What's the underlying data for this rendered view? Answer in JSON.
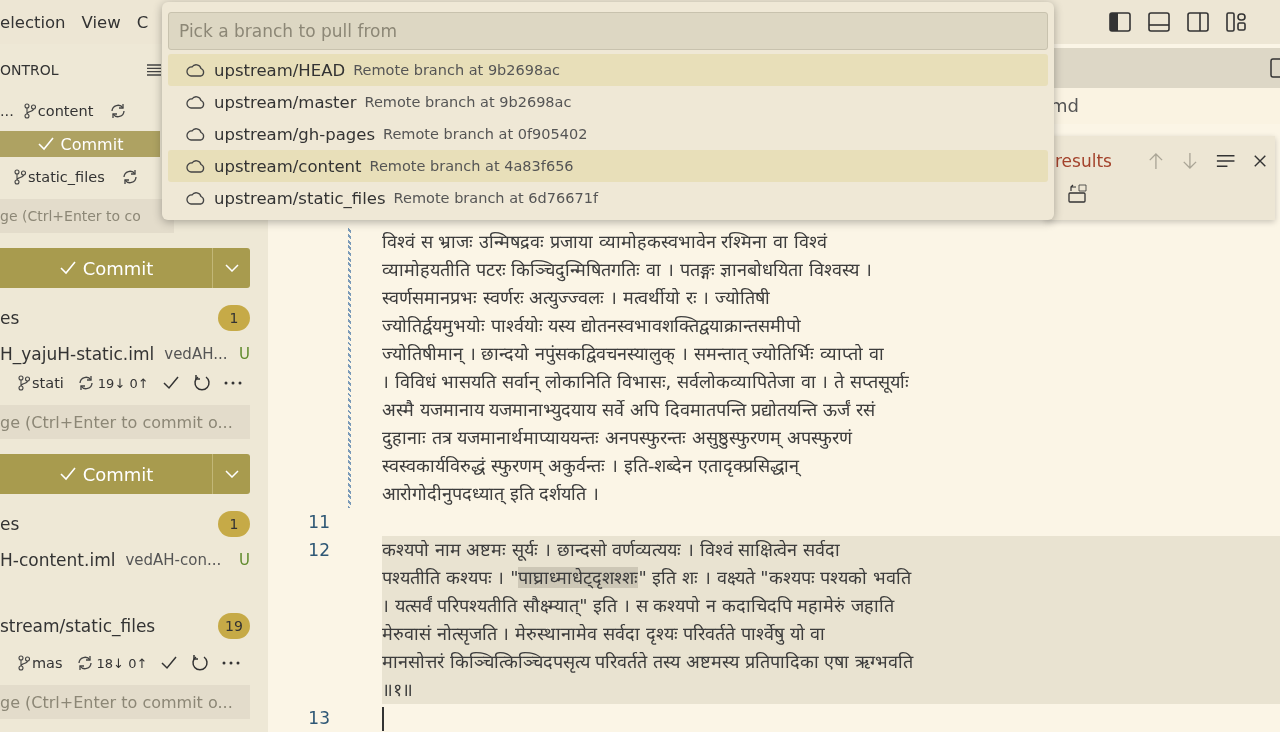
{
  "menu_bar": {
    "items": [
      "election",
      "View",
      "C"
    ]
  },
  "sidebar": {
    "title": "ONTROL",
    "rows": [
      {
        "kind": "branch",
        "prefix": "...",
        "branch": "content",
        "actions": false
      },
      {
        "kind": "commit",
        "label": "Commit",
        "disabled": true
      },
      {
        "kind": "branch",
        "branch": "static_files",
        "actions": false
      },
      {
        "kind": "input",
        "placeholder": "ge (Ctrl+Enter to co"
      },
      {
        "kind": "commit",
        "label": "Commit",
        "disabled": false
      },
      {
        "kind": "group",
        "label": "es",
        "count": "1"
      },
      {
        "kind": "file",
        "name": "H_yajuH-static.iml",
        "path": "vedAH...",
        "status": "U"
      },
      {
        "kind": "branch",
        "branch": "stati",
        "sync": "19↓ 0↑",
        "actions": true
      },
      {
        "kind": "input",
        "placeholder": "ge (Ctrl+Enter to commit o..."
      },
      {
        "kind": "commit",
        "label": "Commit",
        "disabled": false
      },
      {
        "kind": "group",
        "label": "es",
        "count": "1"
      },
      {
        "kind": "file",
        "name": "H-content.iml",
        "path": "vedAH-con...",
        "status": "U"
      },
      {
        "kind": "repo",
        "label": "stream/static_files",
        "count": "19"
      },
      {
        "kind": "branch",
        "branch": "mas",
        "sync": "18↓ 0↑",
        "actions": true
      },
      {
        "kind": "input",
        "placeholder": "ge (Ctrl+Enter to commit o..."
      }
    ]
  },
  "quick_pick": {
    "placeholder": "Pick a branch to pull from",
    "items": [
      {
        "label": "upstream/HEAD",
        "description": "Remote branch at 9b2698ac",
        "selected": true
      },
      {
        "label": "upstream/master",
        "description": "Remote branch at 9b2698ac",
        "selected": false
      },
      {
        "label": "upstream/gh-pages",
        "description": "Remote branch at 0f905402",
        "selected": false
      },
      {
        "label": "upstream/content",
        "description": "Remote branch at 4a83f656",
        "selected": true
      },
      {
        "label": "upstream/static_files",
        "description": "Remote branch at 6d76671f",
        "selected": false
      }
    ]
  },
  "breadcrumb": "md",
  "find_widget": {
    "result": "results"
  },
  "editor": {
    "lines": [
      {
        "modified": true,
        "current": false,
        "segments": [
          [
            {
              "text": "विश्वं स भ्राजः उन्मिषद्रवः प्रजाया व्यामोहकस्वभावेन रश्मिना वा विश्वं",
              "match": false
            }
          ],
          [
            {
              "text": "व्यामोहयतीति पटरः किञ्चिदुन्मिषितगतिः वा । पतङ्गः ज्ञानबोधयिता विश्वस्य ।",
              "match": false
            }
          ],
          [
            {
              "text": "स्वर्णसमानप्रभः स्वर्णरः अत्युज्ज्वलः । मत्वर्थीयो रः । ज्योतिषी",
              "match": false
            }
          ],
          [
            {
              "text": "ज्योतिर्द्वयमुभयोः पार्श्वयोः यस्य द्योतनस्वभावशक्तिद्वयाक्रान्तसमीपो",
              "match": false
            }
          ],
          [
            {
              "text": "ज्योतिषीमान् । छान्दयो नपुंसकद्विवचनस्यालुक् । समन्तात् ज्योतिर्भिः व्याप्तो वा",
              "match": false
            }
          ],
          [
            {
              "text": "। विविधं भासयति सर्वान् लोकानिति विभासः, सर्वलोकव्यापितेजा वा । ते सप्तसूर्याः",
              "match": false
            }
          ],
          [
            {
              "text": "अस्मै यजमानाय यजमानाभ्युदयाय सर्वे अपि दिवमातपन्ति प्रद्योतयन्ति ऊर्जं रसं",
              "match": false
            }
          ],
          [
            {
              "text": "दुहानाः तत्र यजमानार्थमाप्याययन्तः अनपस्फुरन्तः असुष्ठुस्फुरणम् अपस्फुरणं",
              "match": false
            }
          ],
          [
            {
              "text": "स्वस्वकार्यविरुद्धं स्फुरणम् अकुर्वन्तः । इति-शब्देन एतादृक्प्रसिद्धान्",
              "match": false
            }
          ],
          [
            {
              "text": "आरोगोदीनुपदध्यात् इति दर्शयति ।",
              "match": false
            }
          ]
        ]
      },
      {
        "number": "11",
        "modified": false,
        "current": false
      },
      {
        "number": "12",
        "modified": false,
        "current": true,
        "segments": [
          [
            {
              "text": "कश्यपो नाम अष्टमः सूर्यः । छान्दसो वर्णव्यत्ययः । विश्वं साक्षित्वेन सर्वदा",
              "match": false
            }
          ],
          [
            {
              "text": "पश्यतीति कश्यपः । \"",
              "match": false
            },
            {
              "text": "पाघ्राध्माधेट्दृशश्शः",
              "match": true
            },
            {
              "text": "\" इति शः । वक्ष्यते \"कश्यपः पश्यको भवति",
              "match": false
            }
          ],
          [
            {
              "text": "। यत्सर्वं परिपश्यतीति सौक्ष्म्यात्\" इति । स कश्यपो न कदाचिदपि महामेरुं जहाति",
              "match": false
            }
          ],
          [
            {
              "text": "मेरुवासं नोत्सृजति । मेरुस्थानामेव सर्वदा दृश्यः परिवर्तते पार्श्वेषु यो वा",
              "match": false
            }
          ],
          [
            {
              "text": "मानसोत्तरं किञ्चित्किञ्चिदपसृत्य परिवर्तते तस्य अष्टमस्य प्रतिपादिका एषा ऋग्भवति",
              "match": false
            }
          ],
          [
            {
              "text": "॥१॥",
              "match": false
            }
          ]
        ]
      },
      {
        "number": "13",
        "modified": false,
        "current": false,
        "cursor": true
      }
    ]
  }
}
